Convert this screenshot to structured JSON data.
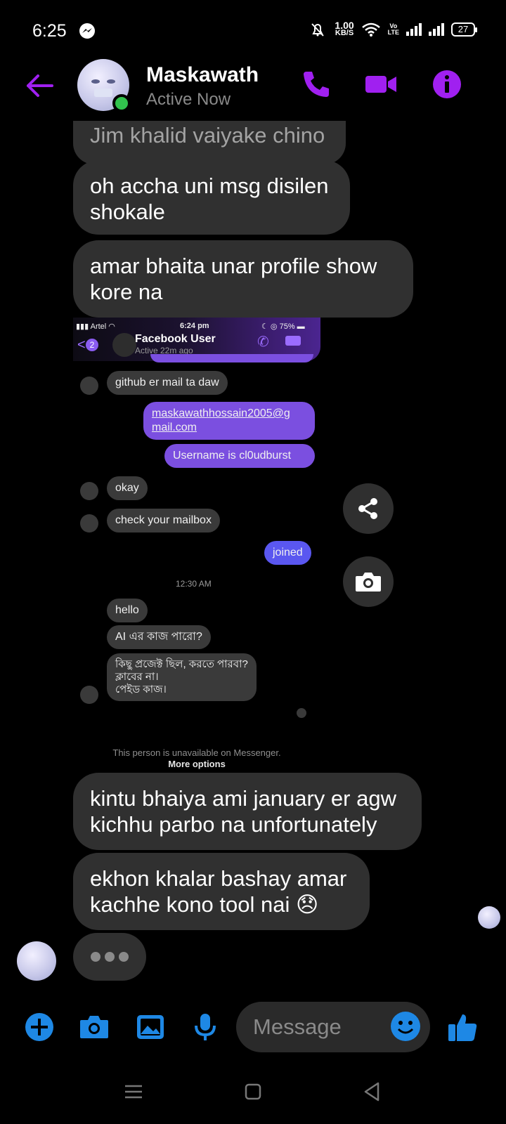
{
  "status_bar": {
    "time": "6:25",
    "net_speed_value": "1.00",
    "net_speed_unit": "KB/S",
    "lte_top": "Vo",
    "lte_bottom": "LTE",
    "battery": "27"
  },
  "header": {
    "name": "Maskawath",
    "status": "Active Now",
    "accent": "#a020f0"
  },
  "messages": [
    {
      "text": "Jim khalid vaiyake chino"
    },
    {
      "text": "oh accha uni msg disilen shokale"
    },
    {
      "text": "amar bhaita unar profile show kore na"
    },
    {
      "text": "kintu bhaiya ami january er agw kichhu parbo na unfortunately"
    },
    {
      "text": "ekhon khalar bashay amar kachhe kono tool nai 😞"
    }
  ],
  "shared_image": {
    "status_left": "Artel",
    "status_time": "6:24 pm",
    "status_battery": "75%",
    "back_badge": "2",
    "contact_name": "Facebook User",
    "contact_status": "Active 22m ago",
    "msgs": {
      "github": "github er mail ta daw",
      "email_line1": "maskawathhossain2005@g",
      "email_line2": "mail.com",
      "username": "Username is cl0udburst",
      "okay": "okay",
      "mailbox": "check your mailbox",
      "joined": "joined",
      "time": "12:30 AM",
      "hello": "hello",
      "ai": "AI এর কাজ পারো?",
      "project_1": "কিছু প্রজেক্ট ছিল, করতে পারবা?",
      "project_2": "ক্লাবের না।",
      "project_3": "পেইড কাজ।"
    },
    "unavailable": "This person is unavailable on Messenger.",
    "more_options": "More options"
  },
  "composer": {
    "placeholder": "Message",
    "icon_color": "#1e88e5"
  }
}
